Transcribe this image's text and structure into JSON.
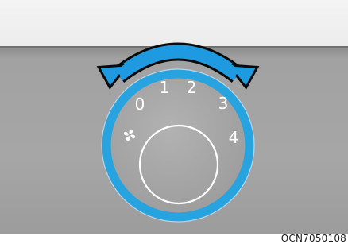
{
  "dial": {
    "positions": [
      "0",
      "1",
      "2",
      "3",
      "4"
    ],
    "fan_icon": "fan-icon"
  },
  "reference_code": "OCN7050108",
  "colors": {
    "panel": "#a4a4a4",
    "knob": "#a9a9a9",
    "ring": "#27a3e0",
    "arrow": "#1f9ae0",
    "arrow_outline": "#0b0b0b",
    "label": "#ffffff"
  }
}
